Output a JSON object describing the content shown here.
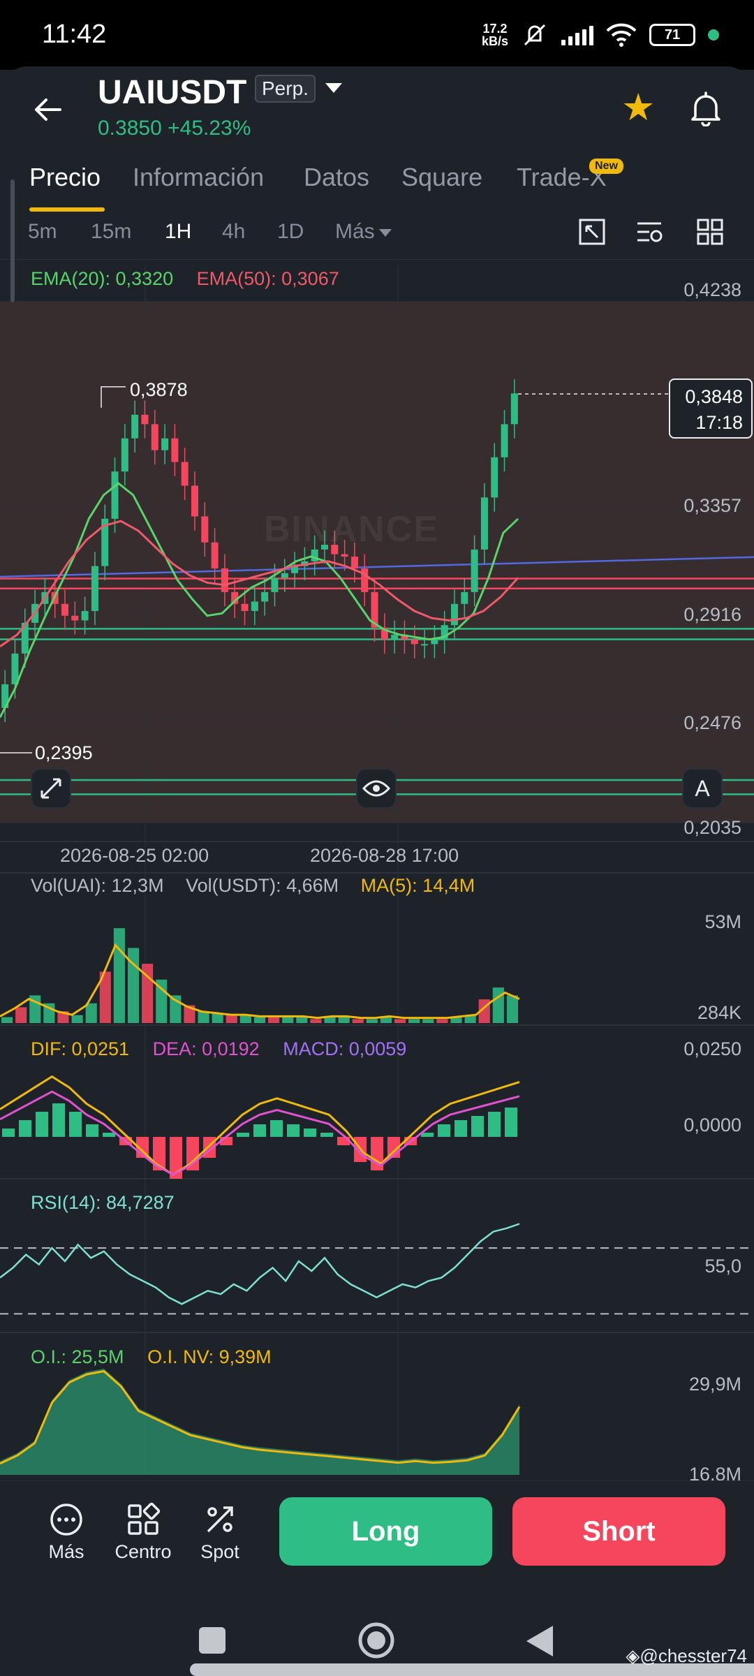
{
  "status_bar": {
    "time": "11:42",
    "net_speed_value": "17.2",
    "net_speed_unit": "kB/s",
    "battery": "71"
  },
  "header": {
    "symbol": "UAIUSDT",
    "contract_type": "Perp.",
    "last_price": "0.3850",
    "change_pct": "+45.23%",
    "price_color": "#2ebd85"
  },
  "tabs": [
    {
      "label": "Precio",
      "active": true
    },
    {
      "label": "Información"
    },
    {
      "label": "Datos"
    },
    {
      "label": "Square"
    },
    {
      "label": "Trade-X",
      "badge": "New"
    }
  ],
  "intervals": [
    {
      "label": "5m"
    },
    {
      "label": "15m"
    },
    {
      "label": "1H",
      "active": true
    },
    {
      "label": "4h"
    },
    {
      "label": "1D"
    },
    {
      "label": "Más"
    }
  ],
  "colors": {
    "green": "#2ebd85",
    "red": "#f6465d",
    "yellow": "#f0b90b",
    "ema20": "#59d36b",
    "ema50": "#f0596a",
    "magenta": "#e052d0",
    "purple": "#a371f7",
    "rsi": "#7de0d1",
    "blue_line": "#5468e0"
  },
  "price_chart": {
    "legend": {
      "ema20": "EMA(20): 0,3320",
      "ema50": "EMA(50): 0,3067"
    },
    "y_axis_labels": [
      "0,4238",
      "0,3357",
      "0,2916",
      "0,2476",
      "0,2035"
    ],
    "high_label": "0,3878",
    "low_label": "0,2395",
    "current_price": "0,3848",
    "countdown": "17:18",
    "x_axis_labels": [
      "2026-08-25 02:00",
      "2026-08-28 17:00"
    ],
    "watermark": "BINANCE",
    "auto_button": "A"
  },
  "volume_panel": {
    "vol_base": "Vol(UAI): 12,3M",
    "vol_quote": "Vol(USDT): 4,66M",
    "ma5": "MA(5): 14,4M",
    "y_max": "53M",
    "y_min": "284K"
  },
  "macd_panel": {
    "dif": "DIF: 0,0251",
    "dea": "DEA: 0,0192",
    "macd": "MACD: 0,0059",
    "y_top": "0,0250",
    "y_zero": "0,0000"
  },
  "rsi_panel": {
    "label": "RSI(14): 84,7287",
    "y_mid": "55,0"
  },
  "oi_panel": {
    "oi": "O.I.: 25,5M",
    "oi_nv": "O.I. NV: 9,39M",
    "y_top": "29,9M",
    "y_bottom": "16,8M"
  },
  "bottom_bar": {
    "more": "Más",
    "center": "Centro",
    "spot": "Spot",
    "long": "Long",
    "short": "Short"
  },
  "watermark_credit": "@chesster74",
  "chart_data": {
    "type": "candlestick",
    "title": "",
    "interval": "1H",
    "y_range": [
      0.2035,
      0.4238
    ],
    "x_labels": [
      "2026-08-25 02:00",
      "2026-08-28 17:00"
    ],
    "close_approx": [
      0.262,
      0.275,
      0.288,
      0.296,
      0.301,
      0.296,
      0.291,
      0.289,
      0.293,
      0.312,
      0.332,
      0.352,
      0.366,
      0.376,
      0.372,
      0.361,
      0.366,
      0.356,
      0.346,
      0.333,
      0.322,
      0.311,
      0.301,
      0.296,
      0.293,
      0.297,
      0.301,
      0.307,
      0.309,
      0.312,
      0.314,
      0.319,
      0.321,
      0.317,
      0.316,
      0.311,
      0.301,
      0.286,
      0.281,
      0.283,
      0.281,
      0.279,
      0.279,
      0.281,
      0.287,
      0.296,
      0.301,
      0.319,
      0.341,
      0.358,
      0.372,
      0.385
    ],
    "ema20_approx": [
      0.248,
      0.26,
      0.276,
      0.29,
      0.303,
      0.316,
      0.332,
      0.342,
      0.347,
      0.342,
      0.33,
      0.318,
      0.306,
      0.298,
      0.291,
      0.292,
      0.298,
      0.303,
      0.306,
      0.31,
      0.314,
      0.316,
      0.314,
      0.307,
      0.298,
      0.289,
      0.285,
      0.283,
      0.282,
      0.281,
      0.282,
      0.286,
      0.292,
      0.307,
      0.326,
      0.332
    ],
    "ema50_approx": [
      0.278,
      0.283,
      0.292,
      0.303,
      0.314,
      0.323,
      0.329,
      0.331,
      0.327,
      0.32,
      0.313,
      0.308,
      0.305,
      0.304,
      0.306,
      0.308,
      0.31,
      0.312,
      0.313,
      0.314,
      0.312,
      0.309,
      0.304,
      0.298,
      0.293,
      0.29,
      0.289,
      0.29,
      0.293,
      0.299,
      0.307
    ],
    "horizontal_lines": [
      {
        "price": 0.3067,
        "color": "red"
      },
      {
        "price": 0.3025,
        "color": "red"
      },
      {
        "price": 0.2855,
        "color": "green"
      },
      {
        "price": 0.281,
        "color": "green"
      },
      {
        "price": 0.2215,
        "color": "green"
      },
      {
        "price": 0.2155,
        "color": "green"
      }
    ],
    "trendline": {
      "color": "blue",
      "from": 0.3075,
      "to": 0.3158
    },
    "high": 0.3878,
    "low": 0.2395,
    "current": 0.3848,
    "volume_approx": [
      3,
      8,
      14,
      10,
      6,
      4,
      10,
      26,
      48,
      38,
      30,
      22,
      14,
      9,
      6,
      5,
      4,
      4,
      3,
      3,
      3,
      3,
      2,
      3,
      3,
      2,
      2,
      3,
      2,
      2,
      2,
      2,
      3,
      4,
      12,
      18,
      14
    ],
    "macd_hist_approx": [
      2,
      4,
      6,
      8,
      6,
      3,
      1,
      -2,
      -5,
      -8,
      -10,
      -8,
      -5,
      -2,
      1,
      3,
      4,
      3,
      2,
      1,
      -2,
      -6,
      -8,
      -5,
      -2,
      1,
      3,
      4,
      5,
      6,
      7
    ],
    "rsi_approx": [
      52,
      58,
      66,
      60,
      70,
      62,
      72,
      64,
      68,
      60,
      54,
      50,
      46,
      40,
      36,
      40,
      44,
      42,
      48,
      44,
      52,
      58,
      50,
      62,
      56,
      64,
      54,
      48,
      44,
      40,
      44,
      48,
      46,
      50,
      52,
      58,
      66,
      74,
      80,
      82,
      84.7
    ],
    "oi_approx": [
      18.5,
      19.5,
      21,
      26,
      28.5,
      29.5,
      29.9,
      28,
      25,
      24,
      23,
      22,
      21.5,
      21,
      20.5,
      20.2,
      20,
      19.8,
      19.6,
      19.4,
      19.2,
      19,
      18.8,
      18.6,
      18.8,
      18.6,
      18.7,
      18.9,
      19.5,
      22,
      25.5
    ]
  }
}
